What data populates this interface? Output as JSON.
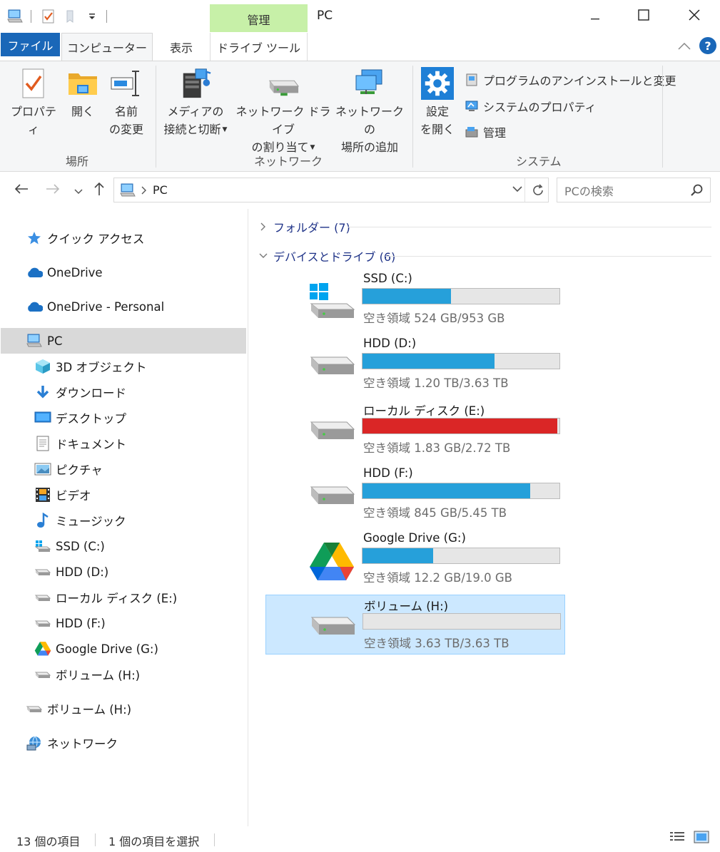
{
  "window": {
    "title": "PC",
    "context_tab": "管理",
    "controls": {
      "minimize": "minimize-icon",
      "maximize": "maximize-icon",
      "close": "close-icon"
    }
  },
  "tabs": {
    "file": "ファイル",
    "computer": "コンピューター",
    "view": "表示",
    "drive_tools": "ドライブ ツール"
  },
  "help_label": "?",
  "ribbon": {
    "location": {
      "label": "場所",
      "properties": "プロパティ",
      "open": "開く",
      "rename_line1": "名前",
      "rename_line2": "の変更"
    },
    "network": {
      "label": "ネットワーク",
      "media_line1": "メディアの",
      "media_line2": "接続と切断",
      "map_line1": "ネットワーク ドライブ",
      "map_line2": "の割り当て",
      "addloc_line1": "ネットワークの",
      "addloc_line2": "場所の追加"
    },
    "system": {
      "label": "システム",
      "settings_line1": "設定",
      "settings_line2": "を開く",
      "uninstall": "プログラムのアンインストールと変更",
      "sysprops": "システムのプロパティ",
      "manage": "管理"
    }
  },
  "address": {
    "path": "PC",
    "search_placeholder": "PCの検索"
  },
  "sidebar": {
    "quick_access": "クイック アクセス",
    "onedrive": "OneDrive",
    "onedrive_personal": "OneDrive - Personal",
    "pc": "PC",
    "items": [
      {
        "label": "3D オブジェクト",
        "icon": "3d-objects-icon"
      },
      {
        "label": "ダウンロード",
        "icon": "download-icon"
      },
      {
        "label": "デスクトップ",
        "icon": "desktop-icon"
      },
      {
        "label": "ドキュメント",
        "icon": "document-icon"
      },
      {
        "label": "ピクチャ",
        "icon": "picture-icon"
      },
      {
        "label": "ビデオ",
        "icon": "video-icon"
      },
      {
        "label": "ミュージック",
        "icon": "music-icon"
      },
      {
        "label": "SSD (C:)",
        "icon": "windows-drive-icon"
      },
      {
        "label": "HDD (D:)",
        "icon": "drive-icon"
      },
      {
        "label": "ローカル ディスク (E:)",
        "icon": "drive-icon"
      },
      {
        "label": "HDD (F:)",
        "icon": "drive-icon"
      },
      {
        "label": "Google Drive (G:)",
        "icon": "google-drive-icon"
      },
      {
        "label": "ボリューム (H:)",
        "icon": "drive-icon"
      }
    ],
    "volume_h": "ボリューム (H:)",
    "network": "ネットワーク"
  },
  "content": {
    "folders_group": "フォルダー (7)",
    "devices_group": "デバイスとドライブ (6)",
    "drives": [
      {
        "name": "SSD (C:)",
        "free": "空き領域 524 GB/953 GB",
        "used_fraction": 0.45,
        "bar_color": "#26a0da",
        "icon": "windows-drive-icon"
      },
      {
        "name": "HDD (D:)",
        "free": "空き領域 1.20 TB/3.63 TB",
        "used_fraction": 0.67,
        "bar_color": "#26a0da",
        "icon": "drive-icon"
      },
      {
        "name": "ローカル ディスク (E:)",
        "free": "空き領域 1.83 GB/2.72 TB",
        "used_fraction": 0.99,
        "bar_color": "#da2626",
        "icon": "drive-icon"
      },
      {
        "name": "HDD (F:)",
        "free": "空き領域 845 GB/5.45 TB",
        "used_fraction": 0.85,
        "bar_color": "#26a0da",
        "icon": "drive-icon"
      },
      {
        "name": "Google Drive (G:)",
        "free": "空き領域 12.2 GB/19.0 GB",
        "used_fraction": 0.36,
        "bar_color": "#26a0da",
        "icon": "google-drive-icon"
      },
      {
        "name": "ボリューム (H:)",
        "free": "空き領域 3.63 TB/3.63 TB",
        "used_fraction": 0.0,
        "bar_color": "#26a0da",
        "icon": "drive-icon",
        "selected": true
      }
    ]
  },
  "status": {
    "count": "13 個の項目",
    "selected": "1 個の項目を選択"
  }
}
